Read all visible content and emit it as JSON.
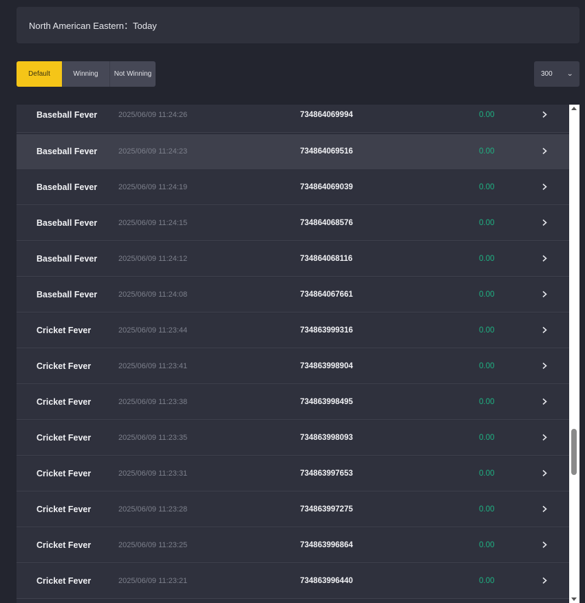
{
  "header": {
    "timezone_label": "North American Eastern：Today"
  },
  "filters": {
    "default_label": "Default",
    "winning_label": "Winning",
    "not_winning_label": "Not Winning"
  },
  "page_size": {
    "value": "300"
  },
  "rows": [
    {
      "game": "Baseball Fever",
      "time": "2025/06/09 11:24:26",
      "ticket": "734864069994",
      "amount": "0.00"
    },
    {
      "game": "Baseball Fever",
      "time": "2025/06/09 11:24:23",
      "ticket": "734864069516",
      "amount": "0.00"
    },
    {
      "game": "Baseball Fever",
      "time": "2025/06/09 11:24:19",
      "ticket": "734864069039",
      "amount": "0.00"
    },
    {
      "game": "Baseball Fever",
      "time": "2025/06/09 11:24:15",
      "ticket": "734864068576",
      "amount": "0.00"
    },
    {
      "game": "Baseball Fever",
      "time": "2025/06/09 11:24:12",
      "ticket": "734864068116",
      "amount": "0.00"
    },
    {
      "game": "Baseball Fever",
      "time": "2025/06/09 11:24:08",
      "ticket": "734864067661",
      "amount": "0.00"
    },
    {
      "game": "Cricket Fever",
      "time": "2025/06/09 11:23:44",
      "ticket": "734863999316",
      "amount": "0.00"
    },
    {
      "game": "Cricket Fever",
      "time": "2025/06/09 11:23:41",
      "ticket": "734863998904",
      "amount": "0.00"
    },
    {
      "game": "Cricket Fever",
      "time": "2025/06/09 11:23:38",
      "ticket": "734863998495",
      "amount": "0.00"
    },
    {
      "game": "Cricket Fever",
      "time": "2025/06/09 11:23:35",
      "ticket": "734863998093",
      "amount": "0.00"
    },
    {
      "game": "Cricket Fever",
      "time": "2025/06/09 11:23:31",
      "ticket": "734863997653",
      "amount": "0.00"
    },
    {
      "game": "Cricket Fever",
      "time": "2025/06/09 11:23:28",
      "ticket": "734863997275",
      "amount": "0.00"
    },
    {
      "game": "Cricket Fever",
      "time": "2025/06/09 11:23:25",
      "ticket": "734863996864",
      "amount": "0.00"
    },
    {
      "game": "Cricket Fever",
      "time": "2025/06/09 11:23:21",
      "ticket": "734863996440",
      "amount": "0.00"
    }
  ],
  "icons": {
    "row_action": "chevron-right-icon",
    "dropdown": "chevron-down-icon"
  },
  "colors": {
    "accent": "#f5c518",
    "amount": "#1fb383",
    "background": "#23252f"
  }
}
